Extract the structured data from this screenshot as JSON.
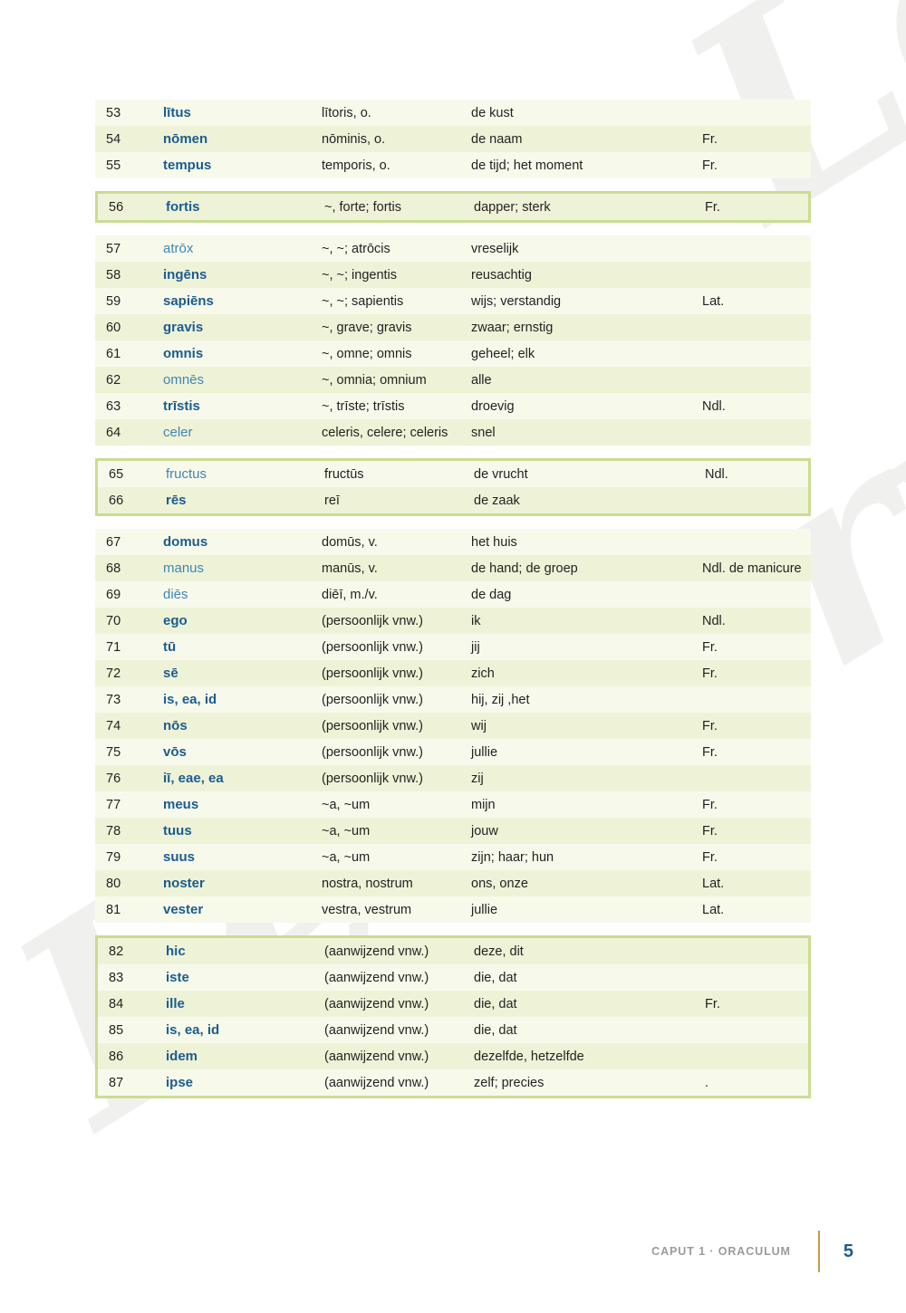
{
  "document": {
    "watermark_text": "Leeservaring",
    "footer": {
      "chapter_label": "CAPUT 1 · ORACULUM",
      "page_number": "5",
      "divider_color": "#c59a4a",
      "chapter_color": "#9b9b9b",
      "page_number_color": "#1c5c8e"
    }
  },
  "colors": {
    "row_even": "#eef3d8",
    "row_odd": "#f7faeb",
    "box_border": "#cbdc93",
    "lemma_bold": "#1c5c8e",
    "lemma_regular": "#3f86b4",
    "body_text": "#231f20"
  },
  "table": {
    "columns": [
      "nr",
      "lemma",
      "forms",
      "meaning",
      "note"
    ],
    "blocks": [
      {
        "boxed": false,
        "rows": [
          {
            "nr": "53",
            "lemma": "lītus",
            "bold": true,
            "forms": "lītoris, o.",
            "meaning": "de kust",
            "note": ""
          },
          {
            "nr": "54",
            "lemma": "nōmen",
            "bold": true,
            "forms": "nōminis, o.",
            "meaning": "de naam",
            "note": "Fr."
          },
          {
            "nr": "55",
            "lemma": "tempus",
            "bold": true,
            "forms": "temporis, o.",
            "meaning": "de tijd; het moment",
            "note": "Fr."
          }
        ]
      },
      {
        "boxed": true,
        "rows": [
          {
            "nr": "56",
            "lemma": "fortis",
            "bold": true,
            "forms": "~, forte; fortis",
            "meaning": "dapper; sterk",
            "note": "Fr."
          }
        ]
      },
      {
        "boxed": false,
        "rows": [
          {
            "nr": "57",
            "lemma": "atrōx",
            "bold": false,
            "forms": "~, ~; atrōcis",
            "meaning": "vreselijk",
            "note": ""
          },
          {
            "nr": "58",
            "lemma": "ingēns",
            "bold": true,
            "forms": "~, ~; ingentis",
            "meaning": "reusachtig",
            "note": ""
          },
          {
            "nr": "59",
            "lemma": "sapiēns",
            "bold": true,
            "forms": "~, ~; sapientis",
            "meaning": "wijs; verstandig",
            "note": "Lat."
          },
          {
            "nr": "60",
            "lemma": "gravis",
            "bold": true,
            "forms": "~, grave; gravis",
            "meaning": "zwaar; ernstig",
            "note": ""
          },
          {
            "nr": "61",
            "lemma": "omnis",
            "bold": true,
            "forms": "~, omne; omnis",
            "meaning": "geheel; elk",
            "note": ""
          },
          {
            "nr": "62",
            "lemma": "omnēs",
            "bold": false,
            "forms": "~, omnia; omnium",
            "meaning": "alle",
            "note": ""
          },
          {
            "nr": "63",
            "lemma": "trīstis",
            "bold": true,
            "forms": "~, trīste; trīstis",
            "meaning": "droevig",
            "note": "Ndl."
          },
          {
            "nr": "64",
            "lemma": "celer",
            "bold": false,
            "forms": "celeris, celere; celeris",
            "meaning": "snel",
            "note": ""
          }
        ]
      },
      {
        "boxed": true,
        "rows": [
          {
            "nr": "65",
            "lemma": "fructus",
            "bold": false,
            "forms": "fructūs",
            "meaning": "de vrucht",
            "note": "Ndl."
          },
          {
            "nr": "66",
            "lemma": "rēs",
            "bold": true,
            "forms": "reī",
            "meaning": "de zaak",
            "note": ""
          }
        ]
      },
      {
        "boxed": false,
        "rows": [
          {
            "nr": "67",
            "lemma": "domus",
            "bold": true,
            "forms": "domūs, v.",
            "meaning": "het huis",
            "note": ""
          },
          {
            "nr": "68",
            "lemma": "manus",
            "bold": false,
            "forms": "manūs, v.",
            "meaning": "de hand; de groep",
            "note": "Ndl. de manicure"
          },
          {
            "nr": "69",
            "lemma": "diēs",
            "bold": false,
            "forms": "diēī, m./v.",
            "meaning": "de dag",
            "note": ""
          },
          {
            "nr": "70",
            "lemma": "ego",
            "bold": true,
            "forms": "(persoonlijk vnw.)",
            "meaning": "ik",
            "note": "Ndl."
          },
          {
            "nr": "71",
            "lemma": "tū",
            "bold": true,
            "forms": "(persoonlijk vnw.)",
            "meaning": "jij",
            "note": "Fr."
          },
          {
            "nr": "72",
            "lemma": "sē",
            "bold": true,
            "forms": "(persoonlijk vnw.)",
            "meaning": "zich",
            "note": "Fr."
          },
          {
            "nr": "73",
            "lemma": "is, ea, id",
            "bold": true,
            "forms": "(persoonlijk vnw.)",
            "meaning": "hij, zij ,het",
            "note": ""
          },
          {
            "nr": "74",
            "lemma": "nōs",
            "bold": true,
            "forms": "(persoonlijk vnw.)",
            "meaning": "wij",
            "note": "Fr."
          },
          {
            "nr": "75",
            "lemma": "vōs",
            "bold": true,
            "forms": "(persoonlijk vnw.)",
            "meaning": "jullie",
            "note": "Fr."
          },
          {
            "nr": "76",
            "lemma": "iī, eae, ea",
            "bold": true,
            "forms": "(persoonlijk vnw.)",
            "meaning": "zij",
            "note": ""
          },
          {
            "nr": "77",
            "lemma": "meus",
            "bold": true,
            "forms": "~a, ~um",
            "meaning": "mijn",
            "note": "Fr."
          },
          {
            "nr": "78",
            "lemma": "tuus",
            "bold": true,
            "forms": "~a, ~um",
            "meaning": "jouw",
            "note": "Fr."
          },
          {
            "nr": "79",
            "lemma": "suus",
            "bold": true,
            "forms": "~a, ~um",
            "meaning": "zijn; haar; hun",
            "note": "Fr."
          },
          {
            "nr": "80",
            "lemma": "noster",
            "bold": true,
            "forms": "nostra, nostrum",
            "meaning": "ons, onze",
            "note": "Lat."
          },
          {
            "nr": "81",
            "lemma": "vester",
            "bold": true,
            "forms": "vestra, vestrum",
            "meaning": "jullie",
            "note": "Lat."
          }
        ]
      },
      {
        "boxed": true,
        "rows": [
          {
            "nr": "82",
            "lemma": "hic",
            "bold": true,
            "forms": "(aanwijzend vnw.)",
            "meaning": "deze, dit",
            "note": ""
          },
          {
            "nr": "83",
            "lemma": "iste",
            "bold": true,
            "forms": "(aanwijzend vnw.)",
            "meaning": "die, dat",
            "note": ""
          },
          {
            "nr": "84",
            "lemma": "ille",
            "bold": true,
            "forms": "(aanwijzend vnw.)",
            "meaning": "die, dat",
            "note": "Fr."
          },
          {
            "nr": "85",
            "lemma": "is, ea, id",
            "bold": true,
            "forms": "(aanwijzend vnw.)",
            "meaning": "die, dat",
            "note": ""
          },
          {
            "nr": "86",
            "lemma": "idem",
            "bold": true,
            "forms": "(aanwijzend vnw.)",
            "meaning": "dezelfde, hetzelfde",
            "note": ""
          },
          {
            "nr": "87",
            "lemma": "ipse",
            "bold": true,
            "forms": "(aanwijzend vnw.)",
            "meaning": "zelf; precies",
            "note": "."
          }
        ]
      }
    ]
  }
}
